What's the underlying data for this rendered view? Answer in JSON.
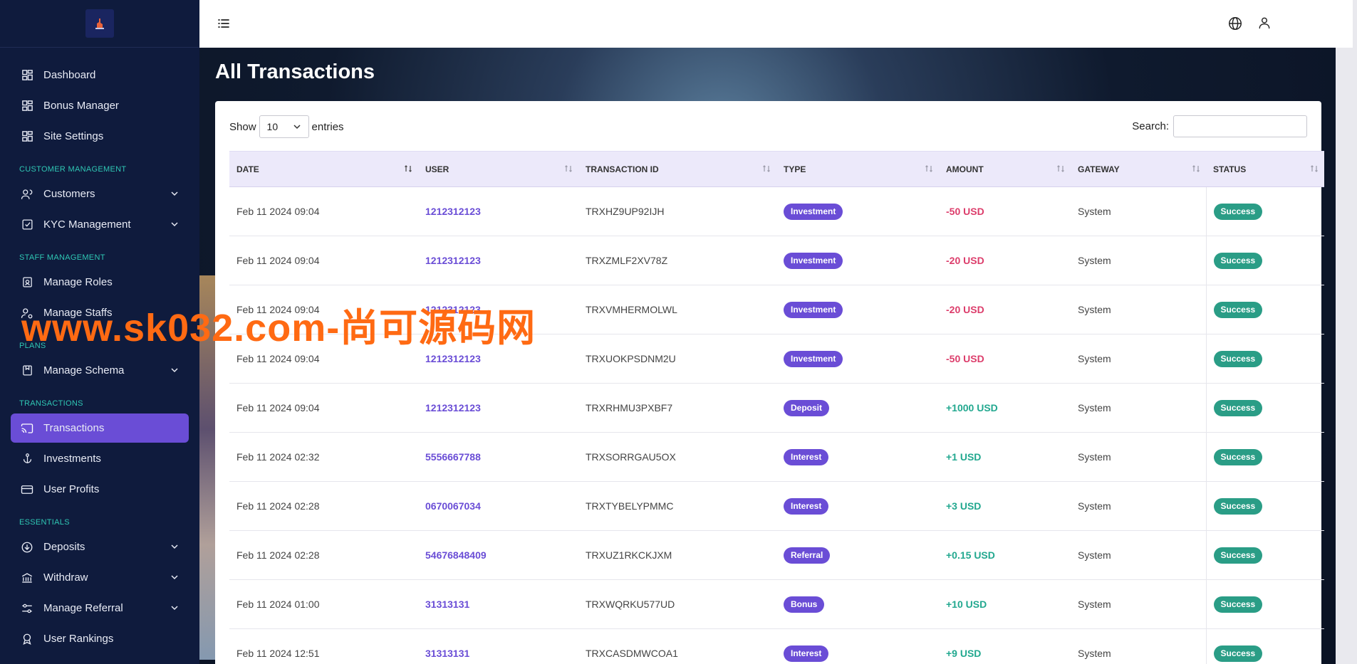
{
  "sidebar": {
    "items": [
      {
        "label": "Dashboard",
        "icon": "grid-icon"
      },
      {
        "label": "Bonus Manager",
        "icon": "grid-icon"
      },
      {
        "label": "Site Settings",
        "icon": "grid-icon"
      }
    ],
    "sections": [
      {
        "title": "CUSTOMER MANAGEMENT",
        "items": [
          {
            "label": "Customers",
            "icon": "users-icon",
            "expandable": true
          },
          {
            "label": "KYC Management",
            "icon": "check-square-icon",
            "expandable": true
          }
        ]
      },
      {
        "title": "STAFF MANAGEMENT",
        "items": [
          {
            "label": "Manage Roles",
            "icon": "id-badge-icon"
          },
          {
            "label": "Manage Staffs",
            "icon": "user-settings-icon"
          }
        ]
      },
      {
        "title": "PLANS",
        "items": [
          {
            "label": "Manage Schema",
            "icon": "bookmark-icon",
            "expandable": true
          }
        ]
      },
      {
        "title": "TRANSACTIONS",
        "items": [
          {
            "label": "Transactions",
            "icon": "cast-icon",
            "active": true
          },
          {
            "label": "Investments",
            "icon": "anchor-icon"
          },
          {
            "label": "User Profits",
            "icon": "credit-card-icon"
          }
        ]
      },
      {
        "title": "ESSENTIALS",
        "items": [
          {
            "label": "Deposits",
            "icon": "arrow-down-circle-icon",
            "expandable": true
          },
          {
            "label": "Withdraw",
            "icon": "bank-icon",
            "expandable": true
          },
          {
            "label": "Manage Referral",
            "icon": "sliders-icon",
            "expandable": true
          },
          {
            "label": "User Rankings",
            "icon": "award-icon"
          }
        ]
      }
    ]
  },
  "page": {
    "title": "All Transactions",
    "show_label": "Show",
    "entries_value": "10",
    "entries_label": "entries",
    "search_label": "Search:",
    "search_value": ""
  },
  "table": {
    "columns": [
      "DATE",
      "USER",
      "TRANSACTION ID",
      "TYPE",
      "AMOUNT",
      "GATEWAY",
      "STATUS"
    ],
    "rows": [
      {
        "date": "Feb 11 2024 09:04",
        "user": "1212312123",
        "txn": "TRXHZ9UP92IJH",
        "type": "Investment",
        "amount": "-50 USD",
        "sign": "neg",
        "gateway": "System",
        "status": "Success"
      },
      {
        "date": "Feb 11 2024 09:04",
        "user": "1212312123",
        "txn": "TRXZMLF2XV78Z",
        "type": "Investment",
        "amount": "-20 USD",
        "sign": "neg",
        "gateway": "System",
        "status": "Success"
      },
      {
        "date": "Feb 11 2024 09:04",
        "user": "1212312123",
        "txn": "TRXVMHERMOLWL",
        "type": "Investment",
        "amount": "-20 USD",
        "sign": "neg",
        "gateway": "System",
        "status": "Success"
      },
      {
        "date": "Feb 11 2024 09:04",
        "user": "1212312123",
        "txn": "TRXUOKPSDNM2U",
        "type": "Investment",
        "amount": "-50 USD",
        "sign": "neg",
        "gateway": "System",
        "status": "Success"
      },
      {
        "date": "Feb 11 2024 09:04",
        "user": "1212312123",
        "txn": "TRXRHMU3PXBF7",
        "type": "Deposit",
        "amount": "+1000 USD",
        "sign": "pos",
        "gateway": "System",
        "status": "Success"
      },
      {
        "date": "Feb 11 2024 02:32",
        "user": "5556667788",
        "txn": "TRXSORRGAU5OX",
        "type": "Interest",
        "amount": "+1 USD",
        "sign": "pos",
        "gateway": "System",
        "status": "Success"
      },
      {
        "date": "Feb 11 2024 02:28",
        "user": "0670067034",
        "txn": "TRXTYBELYPMMC",
        "type": "Interest",
        "amount": "+3 USD",
        "sign": "pos",
        "gateway": "System",
        "status": "Success"
      },
      {
        "date": "Feb 11 2024 02:28",
        "user": "54676848409",
        "txn": "TRXUZ1RKCKJXM",
        "type": "Referral",
        "amount": "+0.15 USD",
        "sign": "pos",
        "gateway": "System",
        "status": "Success"
      },
      {
        "date": "Feb 11 2024 01:00",
        "user": "31313131",
        "txn": "TRXWQRKU577UD",
        "type": "Bonus",
        "amount": "+10 USD",
        "sign": "pos",
        "gateway": "System",
        "status": "Success"
      },
      {
        "date": "Feb 11 2024 12:51",
        "user": "31313131",
        "txn": "TRXCASDMWCOA1",
        "type": "Interest",
        "amount": "+9 USD",
        "sign": "pos",
        "gateway": "System",
        "status": "Success"
      }
    ]
  },
  "watermark": "www.sk032.com-尚可源码网",
  "colors": {
    "sidebar_bg": "#0f1b3d",
    "accent": "#6a4dd6",
    "section_title": "#2fc7b4",
    "success": "#2a9d86",
    "negative": "#dc3d6b",
    "positive": "#22a88f",
    "watermark": "#ff6a13"
  }
}
